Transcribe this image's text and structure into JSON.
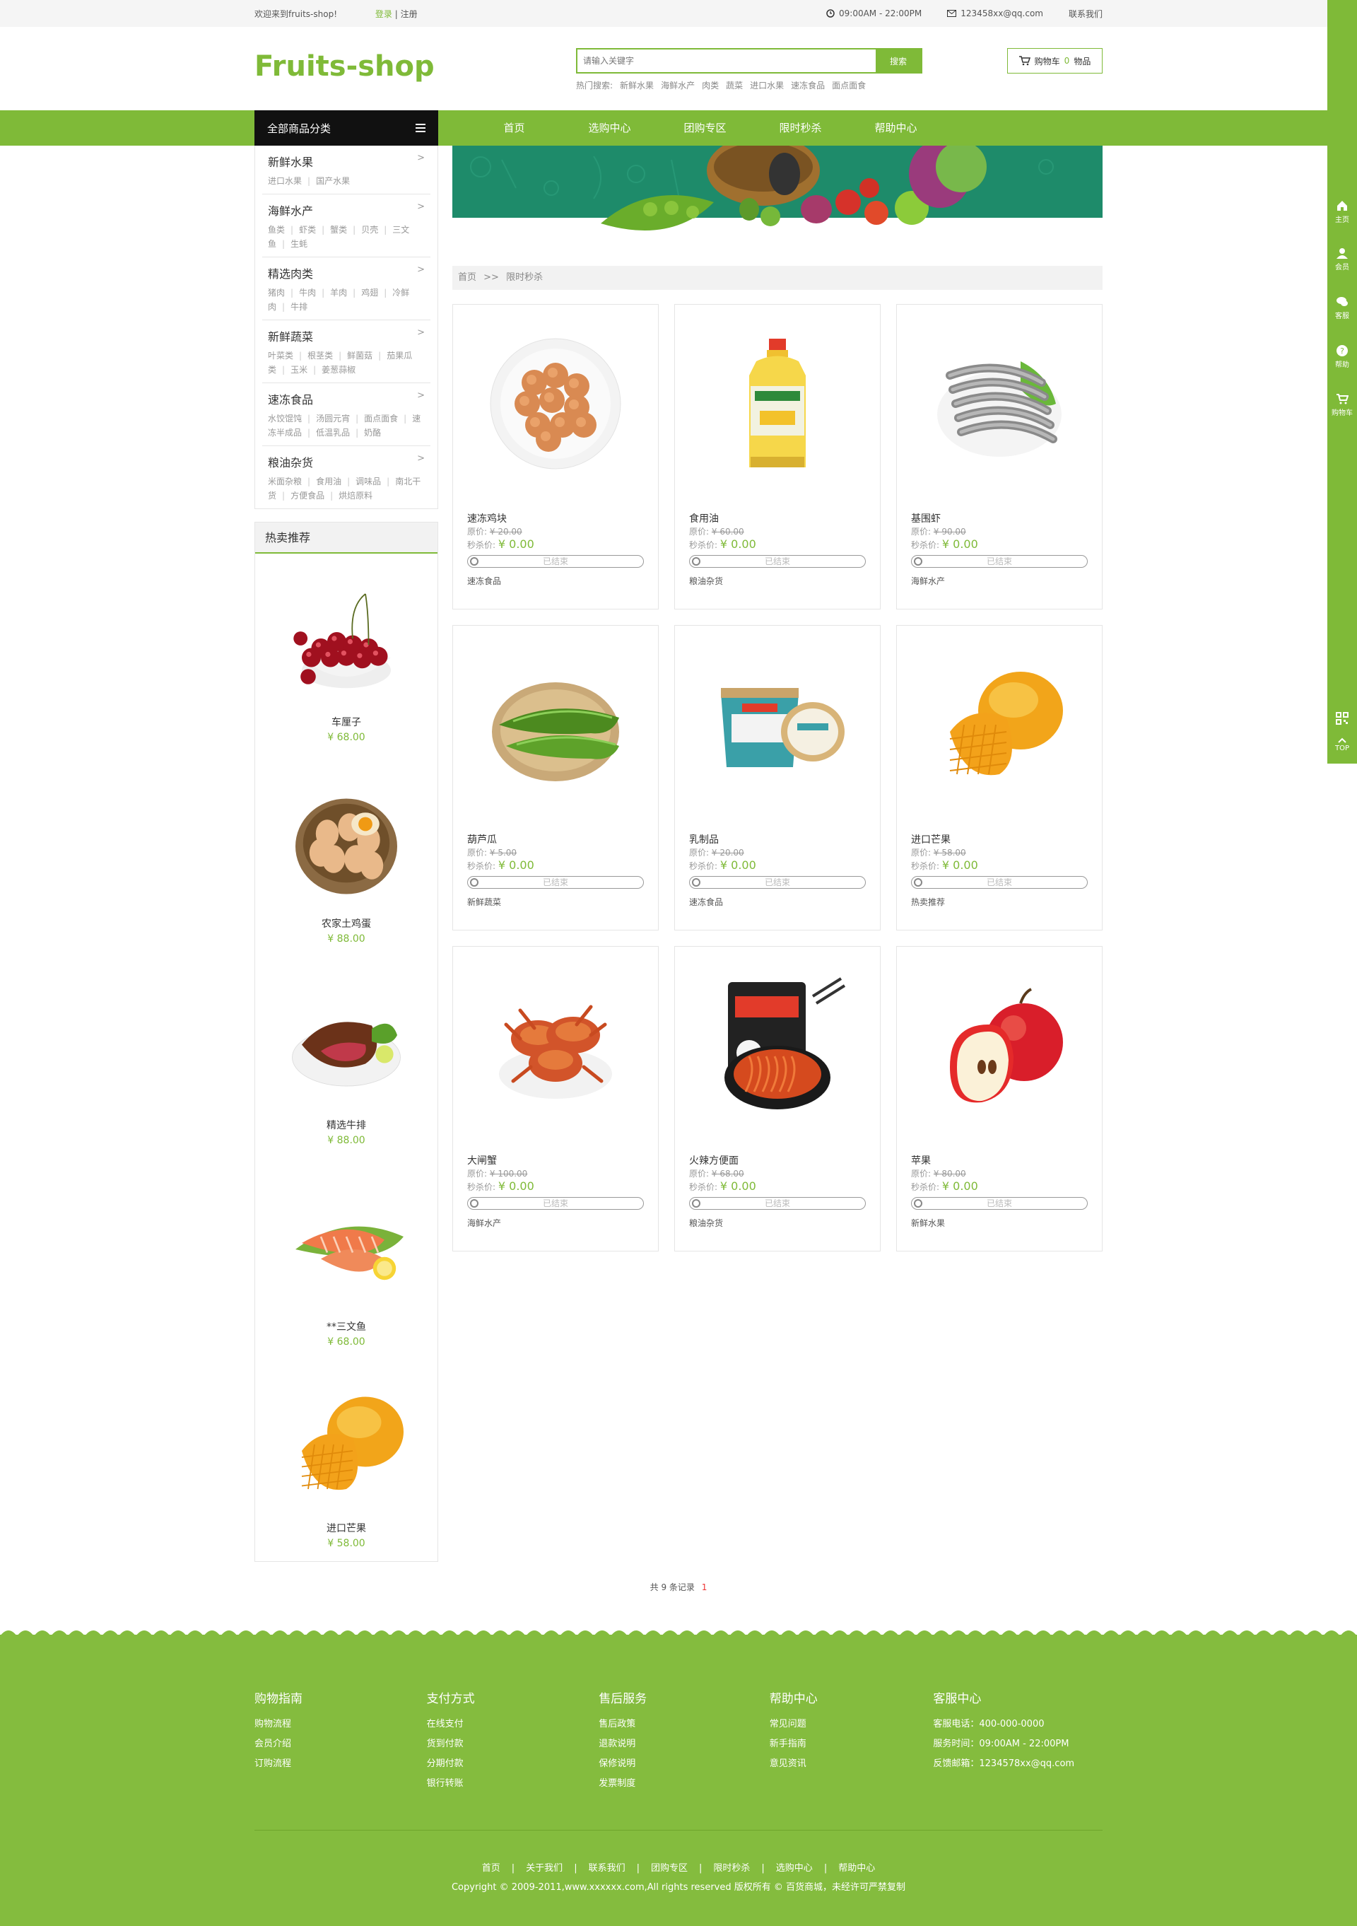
{
  "topbar": {
    "welcome": "欢迎来到fruits-shop!",
    "login": "登录",
    "sep": "|",
    "register": "注册",
    "hours": "09:00AM - 22:00PM",
    "email": "123458xx@qq.com",
    "contact": "联系我们",
    "icons": [
      "clock-icon",
      "mail-icon"
    ]
  },
  "header": {
    "logo": "Fruits-shop",
    "search_placeholder": "请输入关键字",
    "search_button": "搜索",
    "hot_label": "热门搜索:",
    "hot_terms": [
      "新鲜水果",
      "海鲜水产",
      "肉类",
      "蔬菜",
      "进口水果",
      "速冻食品",
      "面点面食"
    ],
    "cart_label": "购物车",
    "cart_count": "0",
    "cart_unit": "物品"
  },
  "nav": {
    "all_categories": "全部商品分类",
    "links": [
      "首页",
      "选购中心",
      "团购专区",
      "限时秒杀",
      "帮助中心"
    ]
  },
  "categories": [
    {
      "title": "新鲜水果",
      "subs": [
        "进口水果",
        "国产水果"
      ]
    },
    {
      "title": "海鲜水产",
      "subs": [
        "鱼类",
        "虾类",
        "蟹类",
        "贝壳",
        "三文鱼",
        "生蚝"
      ]
    },
    {
      "title": "精选肉类",
      "subs": [
        "猪肉",
        "牛肉",
        "羊肉",
        "鸡翅",
        "冷鲜肉",
        "牛排"
      ]
    },
    {
      "title": "新鲜蔬菜",
      "subs": [
        "叶菜类",
        "根茎类",
        "鲜菌菇",
        "茄果瓜类",
        "玉米",
        "姜葱蒜椒"
      ]
    },
    {
      "title": "速冻食品",
      "subs": [
        "水饺馄饨",
        "汤圆元宵",
        "面点面食",
        "速冻半成品",
        "低温乳品",
        "奶酪"
      ]
    },
    {
      "title": "粮油杂货",
      "subs": [
        "米面杂粮",
        "食用油",
        "调味品",
        "南北干货",
        "方便食品",
        "烘焙原料"
      ]
    }
  ],
  "hot_recommend": {
    "title": "热卖推荐",
    "items": [
      {
        "name": "车厘子",
        "price": "¥ 68.00",
        "icon": "cherry-image"
      },
      {
        "name": "农家土鸡蛋",
        "price": "¥ 88.00",
        "icon": "egg-image"
      },
      {
        "name": "精选牛排",
        "price": "¥ 88.00",
        "icon": "steak-image"
      },
      {
        "name": "**三文鱼",
        "price": "¥ 68.00",
        "icon": "salmon-image"
      },
      {
        "name": "进口芒果",
        "price": "¥ 58.00",
        "icon": "mango-image"
      }
    ]
  },
  "breadcrumb": {
    "home": "首页",
    "sep": ">>",
    "current": "限时秒杀"
  },
  "products": {
    "orig_label": "原价:",
    "seckill_label": "秒杀价:",
    "status": "已结束",
    "items": [
      {
        "name": "速冻鸡块",
        "orig": "¥ 20.00",
        "price": "¥ 0.00",
        "tag": "速冻食品",
        "icon": "chicken-nuggets-image"
      },
      {
        "name": "食用油",
        "orig": "¥ 60.00",
        "price": "¥ 0.00",
        "tag": "粮油杂货",
        "icon": "cooking-oil-image"
      },
      {
        "name": "基围虾",
        "orig": "¥ 90.00",
        "price": "¥ 0.00",
        "tag": "海鲜水产",
        "icon": "shrimp-image"
      },
      {
        "name": "葫芦瓜",
        "orig": "¥ 5.00",
        "price": "¥ 0.00",
        "tag": "新鲜蔬菜",
        "icon": "zucchini-image"
      },
      {
        "name": "乳制品",
        "orig": "¥ 20.00",
        "price": "¥ 0.00",
        "tag": "速冻食品",
        "icon": "yogurt-image"
      },
      {
        "name": "进口芒果",
        "orig": "¥ 58.00",
        "price": "¥ 0.00",
        "tag": "热卖推荐",
        "icon": "mango-image"
      },
      {
        "name": "大闸蟹",
        "orig": "¥ 100.00",
        "price": "¥ 0.00",
        "tag": "海鲜水产",
        "icon": "crab-image"
      },
      {
        "name": "火辣方便面",
        "orig": "¥ 68.00",
        "price": "¥ 0.00",
        "tag": "粮油杂货",
        "icon": "noodles-image"
      },
      {
        "name": "苹果",
        "orig": "¥ 80.00",
        "price": "¥ 0.00",
        "tag": "新鲜水果",
        "icon": "apple-image"
      }
    ]
  },
  "pager": {
    "total": "共 9 条记录",
    "current": "1"
  },
  "footer": {
    "columns": [
      {
        "title": "购物指南",
        "links": [
          "购物流程",
          "会员介绍",
          "订购流程"
        ]
      },
      {
        "title": "支付方式",
        "links": [
          "在线支付",
          "货到付款",
          "分期付款",
          "银行转账"
        ]
      },
      {
        "title": "售后服务",
        "links": [
          "售后政策",
          "退款说明",
          "保修说明",
          "发票制度"
        ]
      },
      {
        "title": "帮助中心",
        "links": [
          "常见问题",
          "新手指南",
          "意见资讯"
        ]
      },
      {
        "title": "客服中心",
        "links": [
          "客服电话：400-000-0000",
          "服务时间：09:00AM - 22:00PM",
          "反馈邮箱：1234578xx@qq.com"
        ]
      }
    ],
    "bottom_links": [
      "首页",
      "关于我们",
      "联系我们",
      "团购专区",
      "限时秒杀",
      "选购中心",
      "帮助中心"
    ],
    "link_sep": "|",
    "copyright": "Copyright © 2009-2011,www.xxxxxx.com,All rights reserved 版权所有 © 百货商城，未经许可严禁复制"
  },
  "rightbar": {
    "items": [
      {
        "label": "主页",
        "icon": "home-icon"
      },
      {
        "label": "会员",
        "icon": "user-icon"
      },
      {
        "label": "客服",
        "icon": "chat-icon"
      },
      {
        "label": "帮助",
        "icon": "help-icon"
      },
      {
        "label": "购物车",
        "icon": "cart-icon"
      }
    ],
    "qr_icon": "qrcode-icon",
    "top": "TOP"
  },
  "colors": {
    "accent": "#7fba38",
    "footer": "#84bc3e",
    "dark": "#111111",
    "price_red": "#e33333"
  }
}
